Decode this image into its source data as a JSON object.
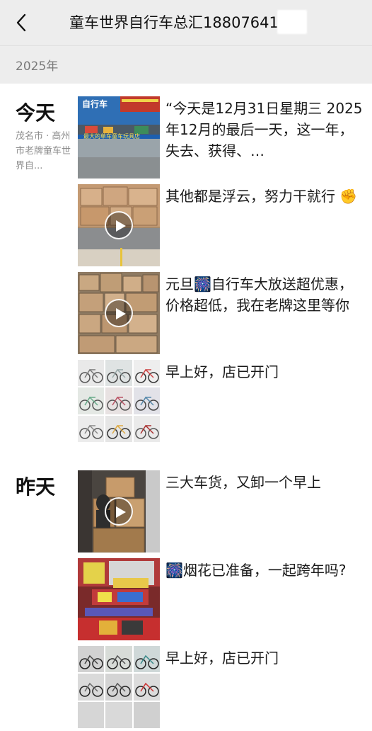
{
  "header": {
    "title": "童车世界自行车总汇18807641",
    "back_icon": "chevron-left-icon"
  },
  "year_label": "2025年",
  "days": [
    {
      "label": "今天",
      "location": "茂名市 · 高州市老牌童车世界自...",
      "posts": [
        {
          "text": "“今天是12月31日星期三 2025年12月的最后一天，这一年，失去、获得、…",
          "media": "photo",
          "shop_sign": "自行车",
          "banner": "最大的单车童车玩具店"
        },
        {
          "text": "其他都是浮云，努力干就行 ✊",
          "media": "video"
        },
        {
          "text": "元旦🎆自行车大放送超优惠，价格超低，我在老牌这里等你",
          "media": "video"
        },
        {
          "text": "早上好，店已开门",
          "media": "grid"
        }
      ]
    },
    {
      "label": "昨天",
      "location": "",
      "posts": [
        {
          "text": "三大车货，又卸一个早上",
          "media": "video"
        },
        {
          "text": "🎆烟花已准备，一起跨年吗?",
          "media": "photo"
        },
        {
          "text": "早上好，店已开门",
          "media": "grid"
        }
      ]
    }
  ],
  "colors": {
    "header_bg": "#ededed",
    "text": "#1a1a1a",
    "muted": "#8c8c8c"
  }
}
